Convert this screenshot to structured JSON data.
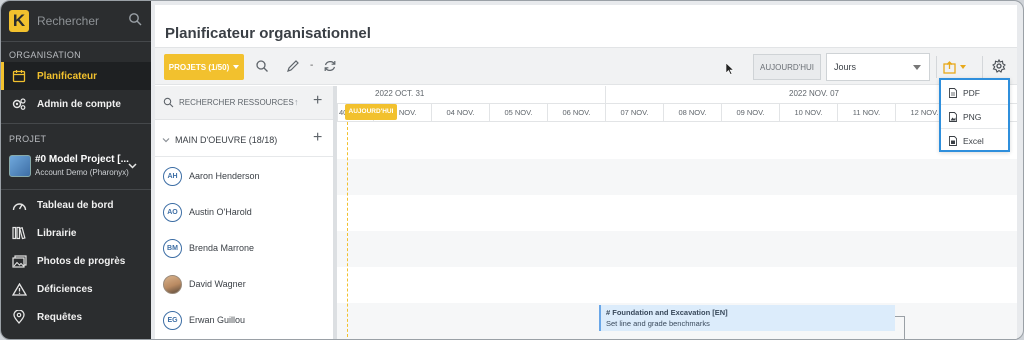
{
  "sidebar": {
    "logo_letter": "K",
    "search_placeholder": "Rechercher",
    "section_org": "ORGANISATION",
    "org_items": [
      {
        "label": "Planificateur",
        "icon": "calendar-icon",
        "active": true
      },
      {
        "label": "Admin de compte",
        "icon": "gears-icon",
        "active": false
      }
    ],
    "section_project": "PROJET",
    "project": {
      "name": "#0 Model Project [...",
      "sub": "Account Demo (Pharonyx)"
    },
    "project_items": [
      {
        "label": "Tableau de bord",
        "icon": "dashboard-icon"
      },
      {
        "label": "Librairie",
        "icon": "library-icon"
      },
      {
        "label": "Photos de progrès",
        "icon": "photos-icon"
      },
      {
        "label": "Déficiences",
        "icon": "warning-icon"
      },
      {
        "label": "Requêtes",
        "icon": "location-pin-icon"
      }
    ]
  },
  "main": {
    "title": "Planificateur organisationnel",
    "toolbar": {
      "projects_label": "PROJETS (1/50)",
      "dash": "-",
      "today_label": "AUJOURD'HUI",
      "scale_value": "Jours"
    },
    "resources": {
      "search_label": "RECHERCHER RESSOURCES",
      "group_label": "MAIN D'OEUVRE (18/18)",
      "rows": [
        {
          "initials": "AH",
          "name": "Aaron Henderson",
          "photo": false
        },
        {
          "initials": "AO",
          "name": "Austin O'Harold",
          "photo": false
        },
        {
          "initials": "BM",
          "name": "Brenda Marrone",
          "photo": false
        },
        {
          "initials": "",
          "name": "David Wagner",
          "photo": true
        },
        {
          "initials": "EG",
          "name": "Erwan Guillou",
          "photo": false
        }
      ]
    },
    "timeline": {
      "weeks": [
        "2022 OCT. 31",
        "2022 NOV. 07"
      ],
      "days": [
        "03 NOV.",
        "04 NOV.",
        "05 NOV.",
        "06 NOV.",
        "07 NOV.",
        "08 NOV.",
        "09 NOV.",
        "10 NOV.",
        "11 NOV.",
        "12 NOV."
      ],
      "today_badge": "AUJOURD'HUI",
      "first_day_fragment": "40",
      "task": {
        "title": "# Foundation and Excavation [EN]",
        "subtitle": "Set line and grade benchmarks"
      }
    },
    "export_menu": [
      "PDF",
      "PNG",
      "Excel"
    ]
  },
  "colors": {
    "accent": "#f2c12e",
    "sidebar_bg": "#2b2d2f",
    "link_blue": "#2f8fdc",
    "task_bg": "#dcecfb"
  }
}
